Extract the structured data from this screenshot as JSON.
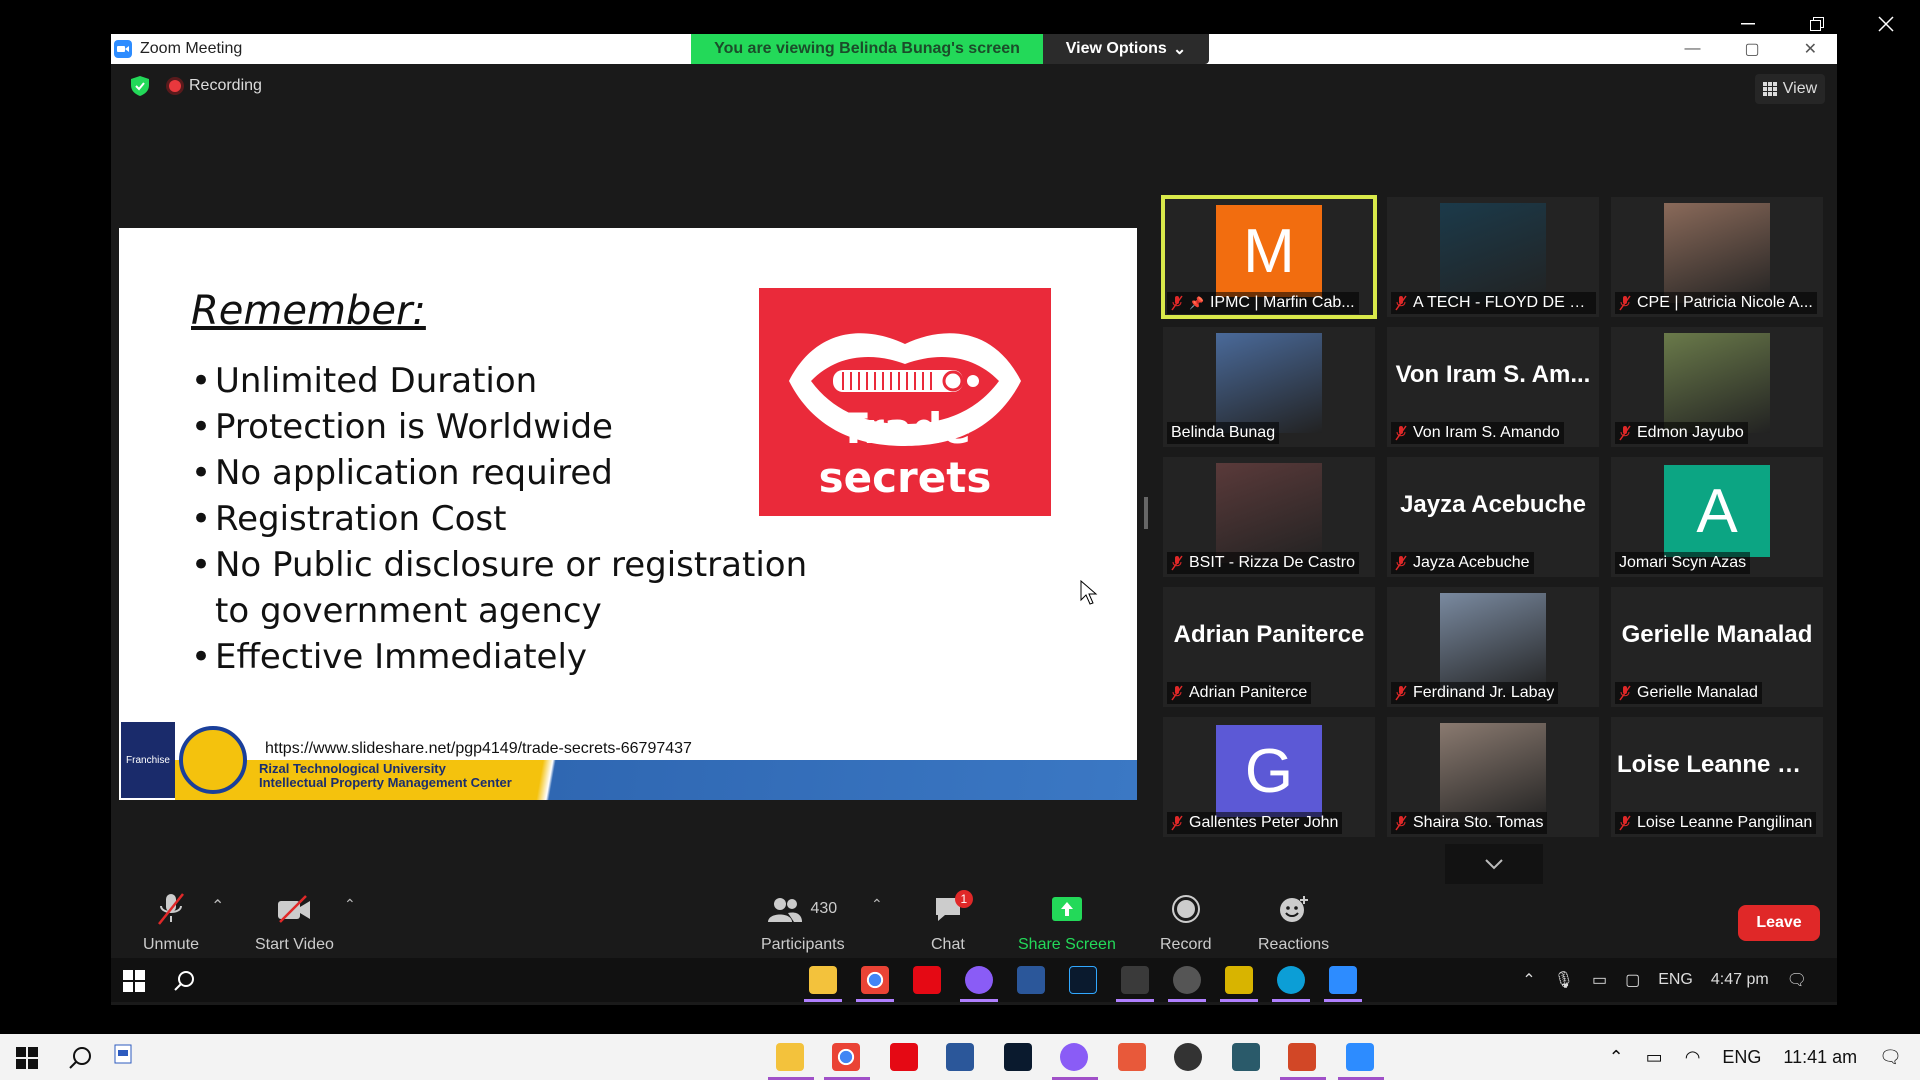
{
  "zoom": {
    "title": "Zoom Meeting",
    "share_banner": "You are viewing Belinda Bunag's screen",
    "view_options": "View Options",
    "recording_label": "Recording",
    "view_label": "View"
  },
  "slide": {
    "title": "Remember:",
    "bullets": [
      "Unlimited Duration",
      "Protection is Worldwide",
      "No application required",
      "Registration Cost",
      "No Public disclosure or registration to government agency",
      "Effective Immediately"
    ],
    "logo_text": "Trade secrets",
    "footer_url": "https://www.slideshare.net/pgp4149/trade-secrets-66797437",
    "footer_univ_line1": "Rizal Technological University",
    "footer_univ_line2": "Intellectual Property Management Center",
    "footer_logo_text": "Franchise"
  },
  "participants": [
    {
      "name": "IPMC | Marfin Cab...",
      "avatar_letter": "M",
      "avatar_color": "#f26d0f",
      "kind": "avatar",
      "active": true,
      "pinned": true
    },
    {
      "name": "A TECH - FLOYD DE VE...",
      "kind": "photo",
      "photo_color": "#1b3a4a"
    },
    {
      "name": "CPE | Patricia Nicole A...",
      "kind": "photo",
      "photo_color": "#8a6a5a"
    },
    {
      "name": "Belinda Bunag",
      "kind": "photo",
      "photo_color": "#4a6a9a",
      "muted": false
    },
    {
      "name": "Von Iram S. Amando",
      "bigname": "Von Iram S. Am...",
      "kind": "text"
    },
    {
      "name": "Edmon Jayubo",
      "kind": "photo",
      "photo_color": "#6a7a4a"
    },
    {
      "name": "BSIT - Rizza De Castro",
      "kind": "photo",
      "photo_color": "#5a3a3a"
    },
    {
      "name": "Jayza Acebuche",
      "bigname": "Jayza Acebuche",
      "kind": "text"
    },
    {
      "name": "Jomari Scyn Azas",
      "avatar_letter": "A",
      "avatar_color": "#0ca583",
      "kind": "avatar",
      "muted": false
    },
    {
      "name": "Adrian Paniterce",
      "bigname": "Adrian Paniterce",
      "kind": "text"
    },
    {
      "name": "Ferdinand Jr. Labay",
      "kind": "photo",
      "photo_color": "#7a8aa0"
    },
    {
      "name": "Gerielle Manalad",
      "bigname": "Gerielle Manalad",
      "kind": "text"
    },
    {
      "name": "Gallentes Peter John",
      "avatar_letter": "G",
      "avatar_color": "#5c59d6",
      "kind": "avatar"
    },
    {
      "name": "Shaira Sto. Tomas",
      "kind": "photo",
      "photo_color": "#8a7a70"
    },
    {
      "name": "Loise Leanne Pangilinan",
      "bigname": "Loise Leanne Pa...",
      "kind": "text"
    }
  ],
  "toolbar": {
    "unmute": "Unmute",
    "start_video": "Start Video",
    "participants": "Participants",
    "participants_count": "430",
    "chat": "Chat",
    "chat_badge": "1",
    "share_screen": "Share Screen",
    "record": "Record",
    "reactions": "Reactions",
    "leave": "Leave"
  },
  "inner_taskbar": {
    "lang": "ENG",
    "time": "4:47 pm"
  },
  "taskbar": {
    "lang": "ENG",
    "time": "11:41 am"
  },
  "colors": {
    "share_green": "#23d959",
    "leave_red": "#e02828",
    "active_outline": "#d9e94a"
  }
}
